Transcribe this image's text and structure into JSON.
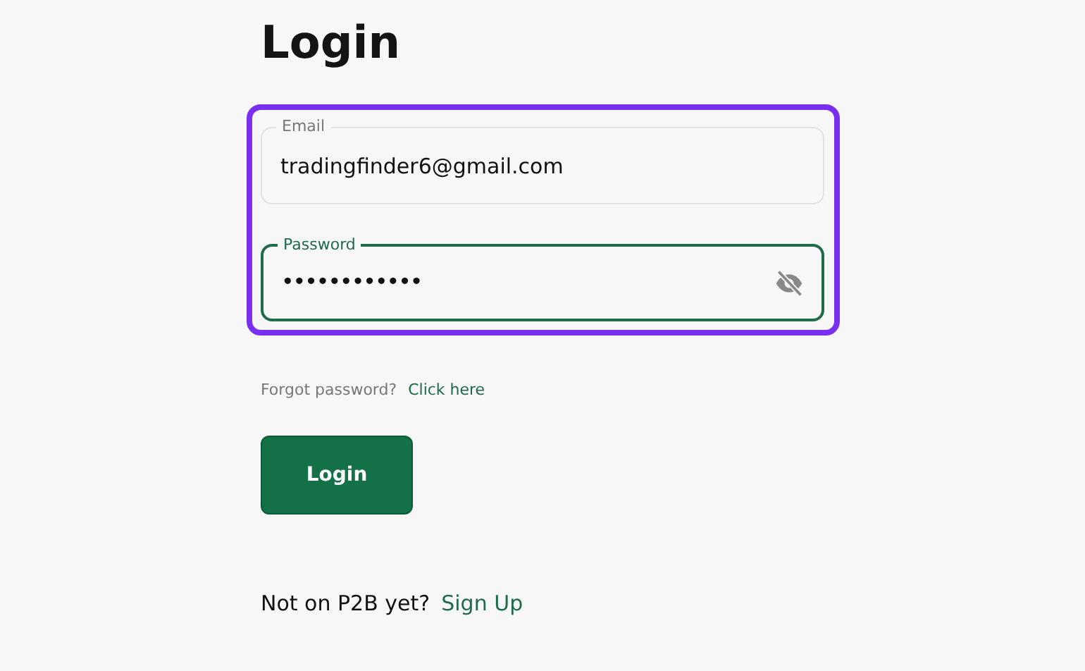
{
  "title": "Login",
  "fields": [
    {
      "label": "Email",
      "value": "tradingfinder6@gmail.com",
      "focused": false,
      "kind": "text"
    },
    {
      "label": "Password",
      "value": "••••••••••••",
      "focused": true,
      "kind": "password"
    }
  ],
  "forgot": {
    "text": "Forgot password?",
    "link": "Click here"
  },
  "login_button": "Login",
  "signup": {
    "text": "Not on P2B yet?",
    "link": "Sign Up"
  }
}
